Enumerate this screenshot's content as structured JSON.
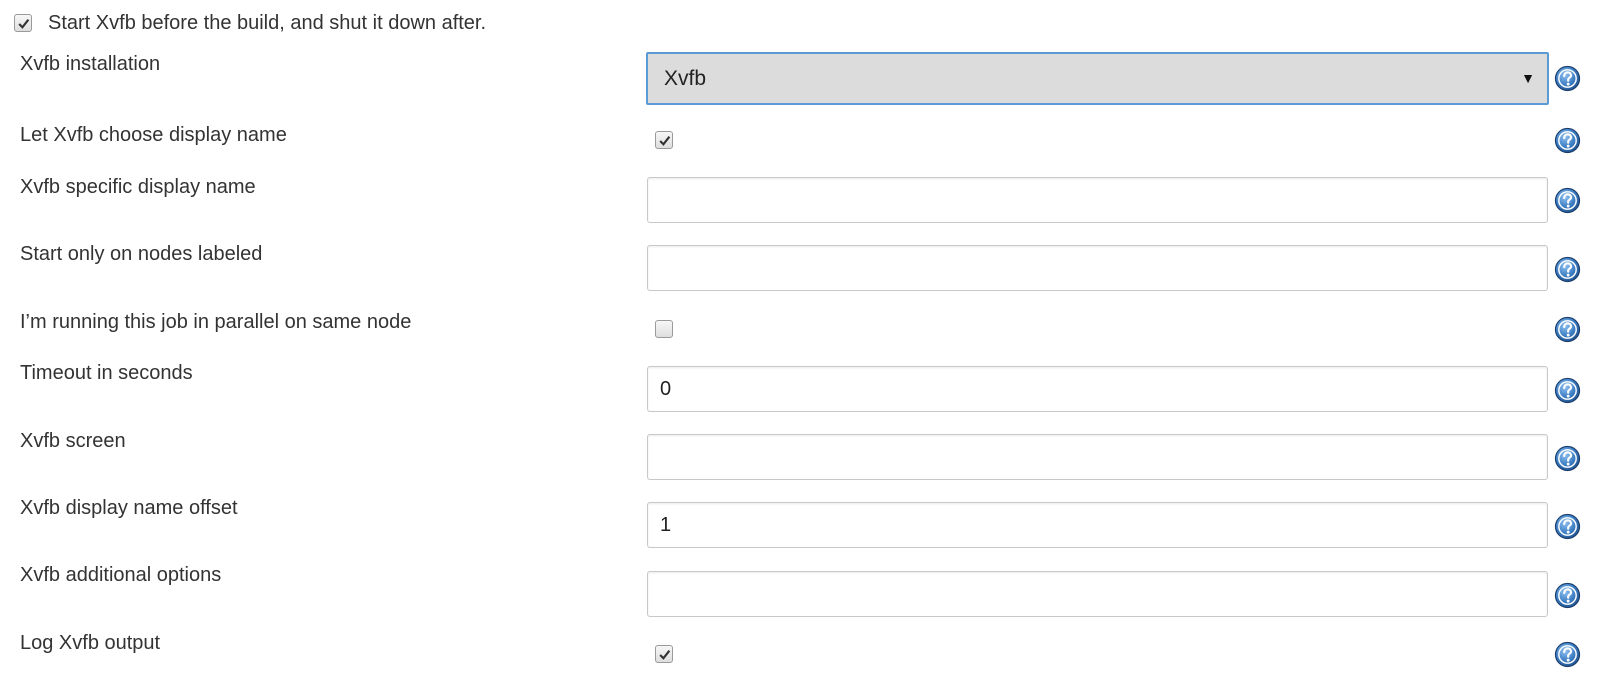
{
  "header": {
    "enable_checked": true,
    "label": "Start Xvfb before the build, and shut it down after."
  },
  "fields": {
    "installation": {
      "label": "Xvfb installation",
      "selected": "Xvfb"
    },
    "auto_display_name": {
      "label": "Let Xvfb choose display name",
      "checked": true
    },
    "display_name": {
      "label": "Xvfb specific display name",
      "value": ""
    },
    "node_label": {
      "label": "Start only on nodes labeled",
      "value": ""
    },
    "parallel": {
      "label": "I’m running this job in parallel on same node",
      "checked": false
    },
    "timeout": {
      "label": "Timeout in seconds",
      "value": "0"
    },
    "screen": {
      "label": "Xvfb screen",
      "value": ""
    },
    "display_offset": {
      "label": "Xvfb display name offset",
      "value": "1"
    },
    "additional_options": {
      "label": "Xvfb additional options",
      "value": ""
    },
    "log_output": {
      "label": "Log Xvfb output",
      "checked": true
    }
  },
  "icons": {
    "help": "help-icon",
    "checkmark": "checkmark-icon",
    "dropdown": "chevron-down-icon"
  },
  "colors": {
    "select_background": "#dcdcdc",
    "select_border": "#5b9bd5",
    "help_icon": "#2b6cb0",
    "text": "#333333"
  }
}
